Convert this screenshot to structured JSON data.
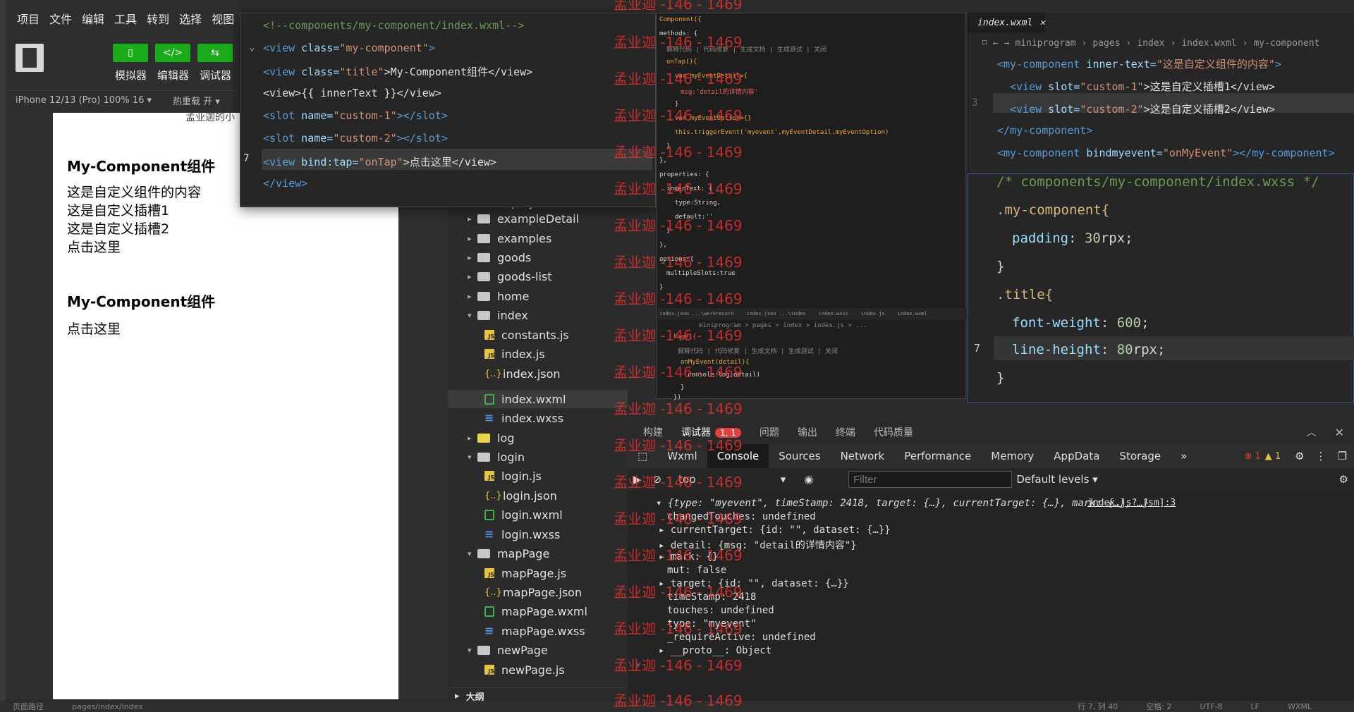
{
  "menu": [
    "项目",
    "文件",
    "编辑",
    "工具",
    "转到",
    "选择",
    "视图"
  ],
  "toolbar": {
    "simulator": "模拟器",
    "editor": "编辑器",
    "debugger": "调试器"
  },
  "device": {
    "model": "iPhone 12/13 (Pro) 100% 16 ▾",
    "hotreload": "热重载 开 ▾"
  },
  "simulator": {
    "partial": "孟业迦的小",
    "heading1": "My-Component组件",
    "lines1": [
      "这是自定义组件的内容",
      "这是自定义插槽1",
      "这是自定义插槽2",
      "点击这里"
    ],
    "heading2": "My-Component组件",
    "lines2": [
      "点击这里"
    ]
  },
  "popup": {
    "l1": "<!--components/my-component/index.wxml-->",
    "l2a": "<view",
    "l2b": " class=",
    "l2c": "\"my-component\"",
    "l2d": ">",
    "l3a": "<view",
    "l3b": " class=",
    "l3c": "\"title\"",
    "l3d": ">My-Component组件</view>",
    "l4": "<view>{{ innerText }}</view>",
    "l5a": "<slot",
    "l5b": " name=",
    "l5c": "\"custom-1\"",
    "l5d": "></slot>",
    "l6a": "<slot",
    "l6b": " name=",
    "l6c": "\"custom-2\"",
    "l6d": "></slot>",
    "l7a": "<view",
    "l7b": " bind:tap=",
    "l7c": "\"onTap\"",
    "l7d": ">点击这里</view>",
    "l8": "</view>"
  },
  "tree": {
    "partial": "deployService",
    "items": [
      "exampleDetail",
      "examples",
      "goods",
      "goods-list",
      "home",
      "index",
      "constants.js",
      "index.js",
      "index.json",
      "index.wxml",
      "index.wxss",
      "log",
      "login",
      "login.js",
      "login.json",
      "login.wxml",
      "login.wxss",
      "mapPage",
      "mapPage.js",
      "mapPage.json",
      "mapPage.wxml",
      "mapPage.wxss",
      "newPage",
      "newPage.js"
    ],
    "outline": "大纲"
  },
  "mini": {
    "l1": "Component({",
    "l2": "methods: {",
    "l3": "解释代码 | 代码修复 | 生成文档 | 生成测试 | 关闭",
    "l4": "onTap(){",
    "l5": "var myEventDetail={",
    "l6": "msg:'detail的详情内容'",
    "l7": "}",
    "l8": "var myEventOption={}",
    "l9": "this.triggerEvent('myevent',myEventDetail,myEventOption)",
    "l10": "}",
    "l11": "},",
    "l12": "properties: {",
    "l13": "innerText: {",
    "l14": "type:String,",
    "l15": "default:''",
    "l16": "}",
    "l17": "},",
    "l18": "options:{",
    "l19": "multipleSlots:true",
    "l20": "}",
    "tabs": [
      "index.json ...\\workrecord",
      "index.json ...\\index",
      "index.wxss",
      "index.js",
      "index.wxml"
    ],
    "b1": "miniprogram > pages > index > index.js > ...",
    "b2": "Page({",
    "b3": "解释代码 | 代码修复 | 生成文档 | 生成测试 | 关闭",
    "b4": "onMyEvent(detail){",
    "b5": "console.log(detail)",
    "b6": "}",
    "b7": "})"
  },
  "editor": {
    "tab": "index.wxml",
    "breadcrumb": [
      "miniprogram",
      "pages",
      "index",
      "index.wxml",
      "my-component"
    ],
    "l1a": "<my-component",
    "l1b": " inner-text=",
    "l1c": "\"这是自定义组件的内容\"",
    "l1d": ">",
    "l2a": "<view",
    "l2b": " slot=",
    "l2c": "\"custom-1\"",
    "l2d": ">这是自定义插槽1</view>",
    "l3a": "<view",
    "l3b": " slot=",
    "l3c": "\"custom-2\"",
    "l3d": ">这是自定义插槽2</view>",
    "l4": "</my-component>",
    "l5a": "<my-component",
    "l5b": " bindmyevent=",
    "l5c": "\"onMyEvent\"",
    "l5d": "></my-component>"
  },
  "wxss": {
    "l1": "/* components/my-component/index.wxss */",
    "l2": ".my-component{",
    "l3a": "padding",
    "l3b": ": ",
    "l3c": "30",
    "l3d": "rpx;",
    "l4": "}",
    "l5": ".title{",
    "l6a": "font-weight",
    "l6b": ": ",
    "l6c": "600",
    "l6d": ";",
    "l7a": "line-height",
    "l7b": ": ",
    "l7c": "80",
    "l7d": "rpx;",
    "l8": "}"
  },
  "debug": {
    "tabs": [
      "构建",
      "调试器",
      "问题",
      "输出",
      "终端",
      "代码质量"
    ],
    "badge": "1, 1",
    "devtabs": [
      "Wxml",
      "Console",
      "Sources",
      "Network",
      "Performance",
      "Memory",
      "AppData",
      "Storage"
    ],
    "errors": "1",
    "warnings": "1",
    "context": "top",
    "filter_placeholder": "Filter",
    "levels": "Default levels ▾",
    "source": "index.js? [sm]:3",
    "c1": "{type: \"myevent\", timeStamp: 2418, target: {…}, currentTarget: {…}, mark: {…}, …}",
    "c2": "changedTouches: undefined",
    "c3": "currentTarget: {id: \"\", dataset: {…}}",
    "c4": "detail: {msg: \"detail的详情内容\"}",
    "c5": "mark: {}",
    "c6": "mut: false",
    "c7": "target: {id: \"\", dataset: {…}}",
    "c8": "timeStamp: 2418",
    "c9": "touches: undefined",
    "c10": "type: \"myevent\"",
    "c11": "_requireActive: undefined",
    "c12": "__proto__: Object"
  },
  "status": [
    "页面路径",
    "pages/index/index",
    "行 7, 列 40",
    "空格: 2",
    "UTF-8",
    "LF",
    "WXML"
  ],
  "watermark": "孟业迦 -146 - 1469"
}
